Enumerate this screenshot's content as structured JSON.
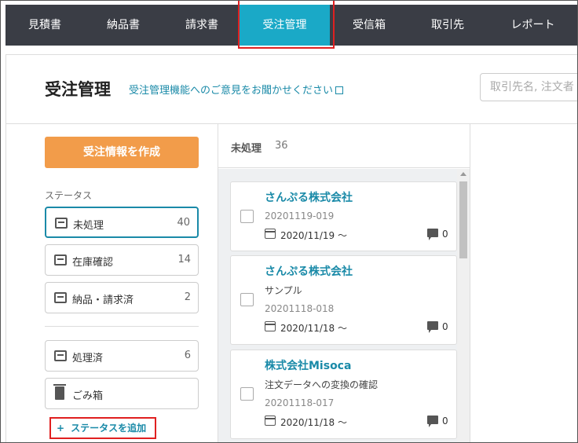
{
  "nav": {
    "items": [
      {
        "label": "見積書"
      },
      {
        "label": "納品書"
      },
      {
        "label": "請求書"
      },
      {
        "label": "受注管理"
      },
      {
        "label": "受信箱"
      },
      {
        "label": "取引先"
      },
      {
        "label": "レポート"
      }
    ],
    "active": "受注管理",
    "active_color": "#1aa9c7"
  },
  "header": {
    "title": "受注管理",
    "feedback_link": "受注管理機能へのご意見をお聞かせください",
    "search_placeholder": "取引先名, 注文者"
  },
  "sidebar": {
    "create_button": "受注情報を作成",
    "status_heading": "ステータス",
    "statuses": [
      {
        "label": "未処理",
        "count": "40",
        "icon": "inbox-icon"
      },
      {
        "label": "在庫確認",
        "count": "14",
        "icon": "inbox-icon"
      },
      {
        "label": "納品・請求済",
        "count": "2",
        "icon": "inbox-icon"
      },
      {
        "label": "処理済",
        "count": "6",
        "icon": "inbox-icon"
      },
      {
        "label": "ごみ箱",
        "count": "",
        "icon": "trash-icon"
      }
    ],
    "add_status": "ステータスを追加",
    "accent_color": "#f29c4a"
  },
  "column": {
    "title": "未処理",
    "count": "36",
    "cards": [
      {
        "company": "さんぷる株式会社",
        "subject": "",
        "id": "20201119-019",
        "date": "2020/11/19 〜",
        "comments": "0"
      },
      {
        "company": "さんぷる株式会社",
        "subject": "サンプル",
        "id": "20201118-018",
        "date": "2020/11/18 〜",
        "comments": "0"
      },
      {
        "company": "株式会社Misoca",
        "subject": "注文データへの変換の確認",
        "id": "20201118-017",
        "date": "2020/11/18 〜",
        "comments": "0"
      }
    ]
  }
}
